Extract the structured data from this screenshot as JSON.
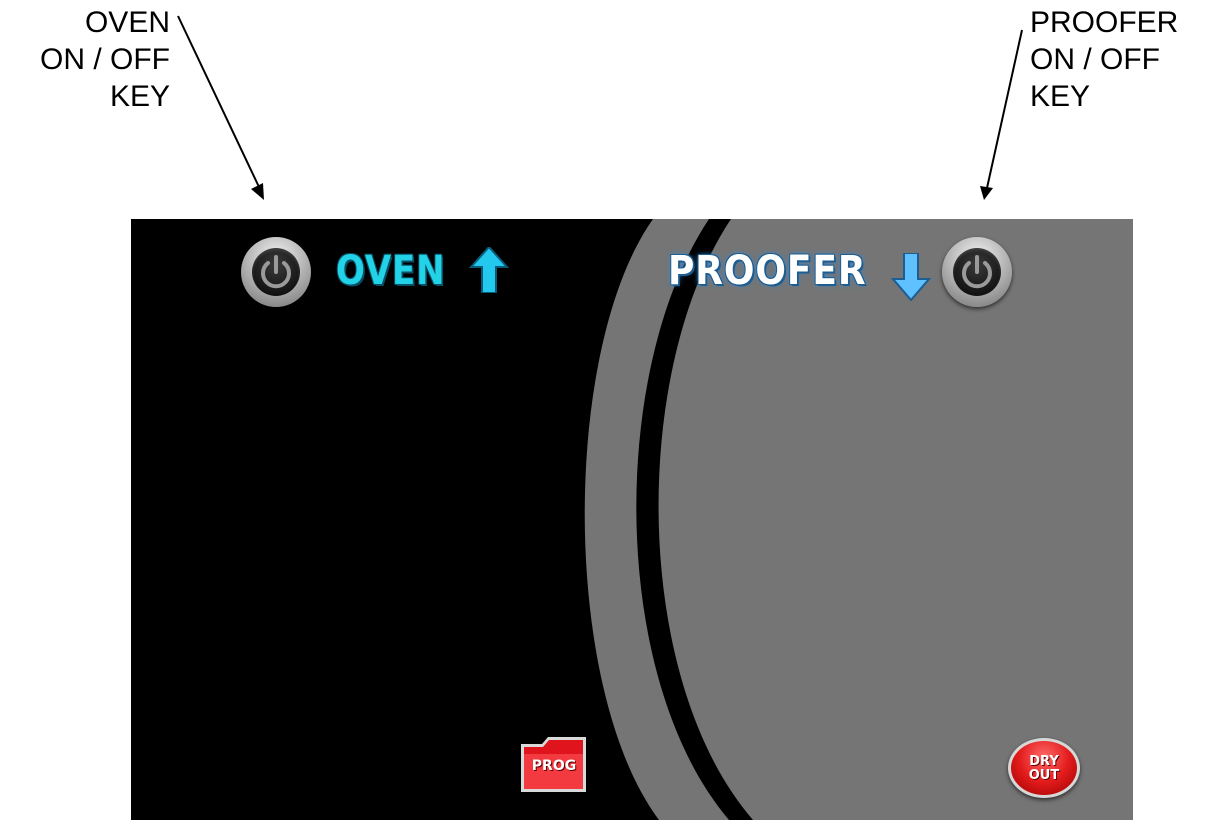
{
  "annotations": {
    "oven_key": {
      "lines": [
        "OVEN",
        "ON / OFF",
        "KEY"
      ]
    },
    "proofer_key": {
      "lines": [
        "PROOFER",
        "ON / OFF",
        "KEY"
      ]
    }
  },
  "screen": {
    "oven": {
      "title": "OVEN",
      "power_icon": "power-icon",
      "arrow_icon": "arrow-up-icon",
      "title_color": "#22d3e8"
    },
    "proofer": {
      "title": "PROOFER",
      "power_icon": "power-icon",
      "arrow_icon": "arrow-down-icon",
      "title_color": "#ffffff"
    },
    "prog_button": {
      "label": "PROG",
      "icon": "folder-icon",
      "color": "#e0141c"
    },
    "dry_out_button": {
      "lines": [
        "DRY",
        "OUT"
      ],
      "color": "#e21b1b"
    },
    "colors": {
      "oven_background": "#000000",
      "proofer_background": "#757575"
    }
  }
}
